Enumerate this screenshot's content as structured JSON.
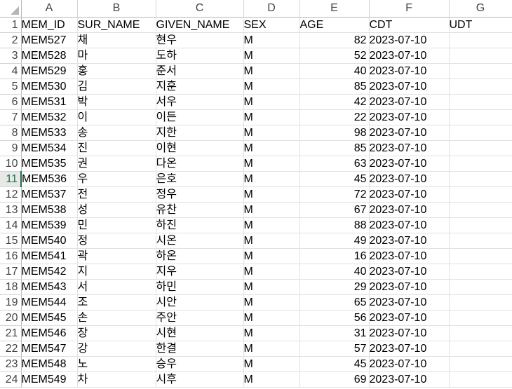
{
  "columns": [
    "A",
    "B",
    "C",
    "D",
    "E",
    "F",
    "G"
  ],
  "rows": [
    {
      "n": "1",
      "cells": [
        "MEM_ID",
        "SUR_NAME",
        "GIVEN_NAME",
        "SEX",
        "AGE",
        "CDT",
        "UDT"
      ]
    },
    {
      "n": "2",
      "cells": [
        "MEM527",
        "채",
        "현우",
        "M",
        "82",
        "2023-07-10",
        ""
      ]
    },
    {
      "n": "3",
      "cells": [
        "MEM528",
        "마",
        "도하",
        "M",
        "52",
        "2023-07-10",
        ""
      ]
    },
    {
      "n": "4",
      "cells": [
        "MEM529",
        "홍",
        "준서",
        "M",
        "40",
        "2023-07-10",
        ""
      ]
    },
    {
      "n": "5",
      "cells": [
        "MEM530",
        "김",
        "지훈",
        "M",
        "85",
        "2023-07-10",
        ""
      ]
    },
    {
      "n": "6",
      "cells": [
        "MEM531",
        "박",
        "서우",
        "M",
        "42",
        "2023-07-10",
        ""
      ]
    },
    {
      "n": "7",
      "cells": [
        "MEM532",
        "이",
        "이든",
        "M",
        "22",
        "2023-07-10",
        ""
      ]
    },
    {
      "n": "8",
      "cells": [
        "MEM533",
        "송",
        "지한",
        "M",
        "98",
        "2023-07-10",
        ""
      ]
    },
    {
      "n": "9",
      "cells": [
        "MEM534",
        "진",
        "이현",
        "M",
        "85",
        "2023-07-10",
        ""
      ]
    },
    {
      "n": "10",
      "cells": [
        "MEM535",
        "권",
        "다온",
        "M",
        "63",
        "2023-07-10",
        ""
      ]
    },
    {
      "n": "11",
      "cells": [
        "MEM536",
        "우",
        "은호",
        "M",
        "45",
        "2023-07-10",
        ""
      ]
    },
    {
      "n": "12",
      "cells": [
        "MEM537",
        "전",
        "정우",
        "M",
        "72",
        "2023-07-10",
        ""
      ]
    },
    {
      "n": "13",
      "cells": [
        "MEM538",
        "성",
        "유찬",
        "M",
        "67",
        "2023-07-10",
        ""
      ]
    },
    {
      "n": "14",
      "cells": [
        "MEM539",
        "민",
        "하진",
        "M",
        "88",
        "2023-07-10",
        ""
      ]
    },
    {
      "n": "15",
      "cells": [
        "MEM540",
        "정",
        "시온",
        "M",
        "49",
        "2023-07-10",
        ""
      ]
    },
    {
      "n": "16",
      "cells": [
        "MEM541",
        "곽",
        "하온",
        "M",
        "16",
        "2023-07-10",
        ""
      ]
    },
    {
      "n": "17",
      "cells": [
        "MEM542",
        "지",
        "지우",
        "M",
        "40",
        "2023-07-10",
        ""
      ]
    },
    {
      "n": "18",
      "cells": [
        "MEM543",
        "서",
        "하민",
        "M",
        "29",
        "2023-07-10",
        ""
      ]
    },
    {
      "n": "19",
      "cells": [
        "MEM544",
        "조",
        "시안",
        "M",
        "65",
        "2023-07-10",
        ""
      ]
    },
    {
      "n": "20",
      "cells": [
        "MEM545",
        "손",
        "주안",
        "M",
        "56",
        "2023-07-10",
        ""
      ]
    },
    {
      "n": "21",
      "cells": [
        "MEM546",
        "장",
        "시현",
        "M",
        "31",
        "2023-07-10",
        ""
      ]
    },
    {
      "n": "22",
      "cells": [
        "MEM547",
        "강",
        "한결",
        "M",
        "57",
        "2023-07-10",
        ""
      ]
    },
    {
      "n": "23",
      "cells": [
        "MEM548",
        "노",
        "승우",
        "M",
        "45",
        "2023-07-10",
        ""
      ]
    },
    {
      "n": "24",
      "cells": [
        "MEM549",
        "차",
        "시후",
        "M",
        "69",
        "2023-07-10",
        ""
      ]
    }
  ],
  "active_row": "11",
  "colors": {
    "active_row_header": "#1e7145",
    "gridline": "#e1e1e1"
  }
}
